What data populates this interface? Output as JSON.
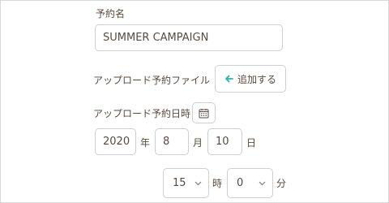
{
  "reservation_name": {
    "label": "予約名",
    "value": "SUMMER CAMPAIGN"
  },
  "upload_file": {
    "label": "アップロード予約ファイル",
    "add_button_label": "追加する",
    "accent_color": "#2bb5a4"
  },
  "upload_datetime": {
    "label": "アップロード予約日時",
    "year_value": "2020",
    "year_unit": "年",
    "month_value": "8",
    "month_unit": "月",
    "day_value": "10",
    "day_unit": "日",
    "hour_value": "15",
    "hour_unit": "時",
    "minute_value": "0",
    "minute_unit": "分"
  }
}
